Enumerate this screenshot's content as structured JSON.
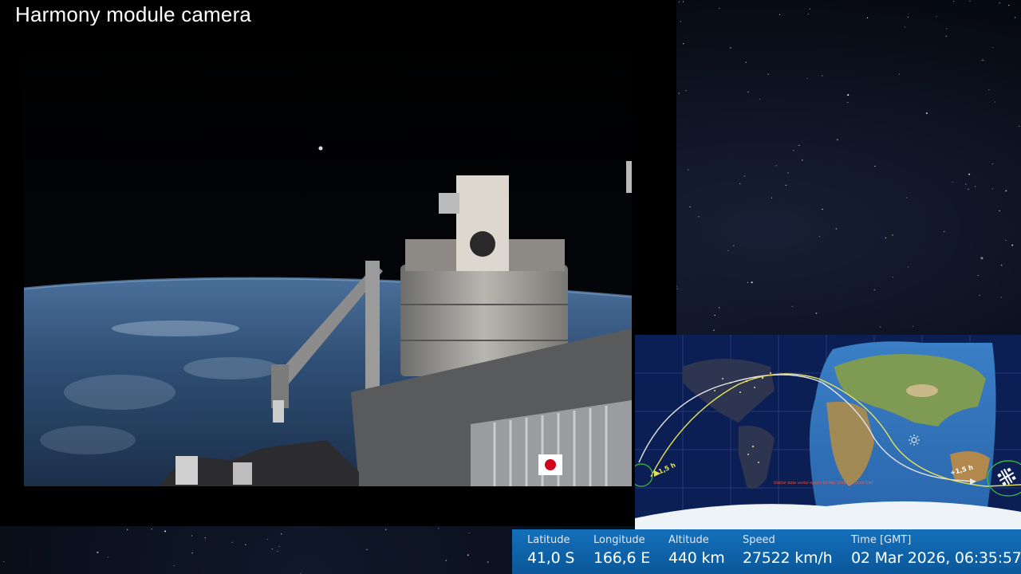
{
  "camera": {
    "title": "Harmony module camera"
  },
  "map": {
    "orbit_markers": {
      "minus": "-1,5 h",
      "plus": "+1,5 h"
    },
    "footnote": "Orbital state vector epoch: 01 Mar 2026, 01:58:00 GMT"
  },
  "telemetry": {
    "latitude": {
      "label": "Latitude",
      "value": "41,0 S"
    },
    "longitude": {
      "label": "Longitude",
      "value": "166,6 E"
    },
    "altitude": {
      "label": "Altitude",
      "value": "440 km"
    },
    "speed": {
      "label": "Speed",
      "value": "27522 km/h"
    },
    "time": {
      "label": "Time [GMT]",
      "value": "02 Mar 2026, 06:35:57"
    }
  },
  "colors": {
    "telemetry_bar": "#0d5fa8",
    "current_orbit": "#e8e25a",
    "previous_orbit": "#e6e6e6",
    "footnote": "#ff5a3c"
  },
  "icons": {
    "sun": "sun-icon",
    "iss": "iss-icon"
  }
}
